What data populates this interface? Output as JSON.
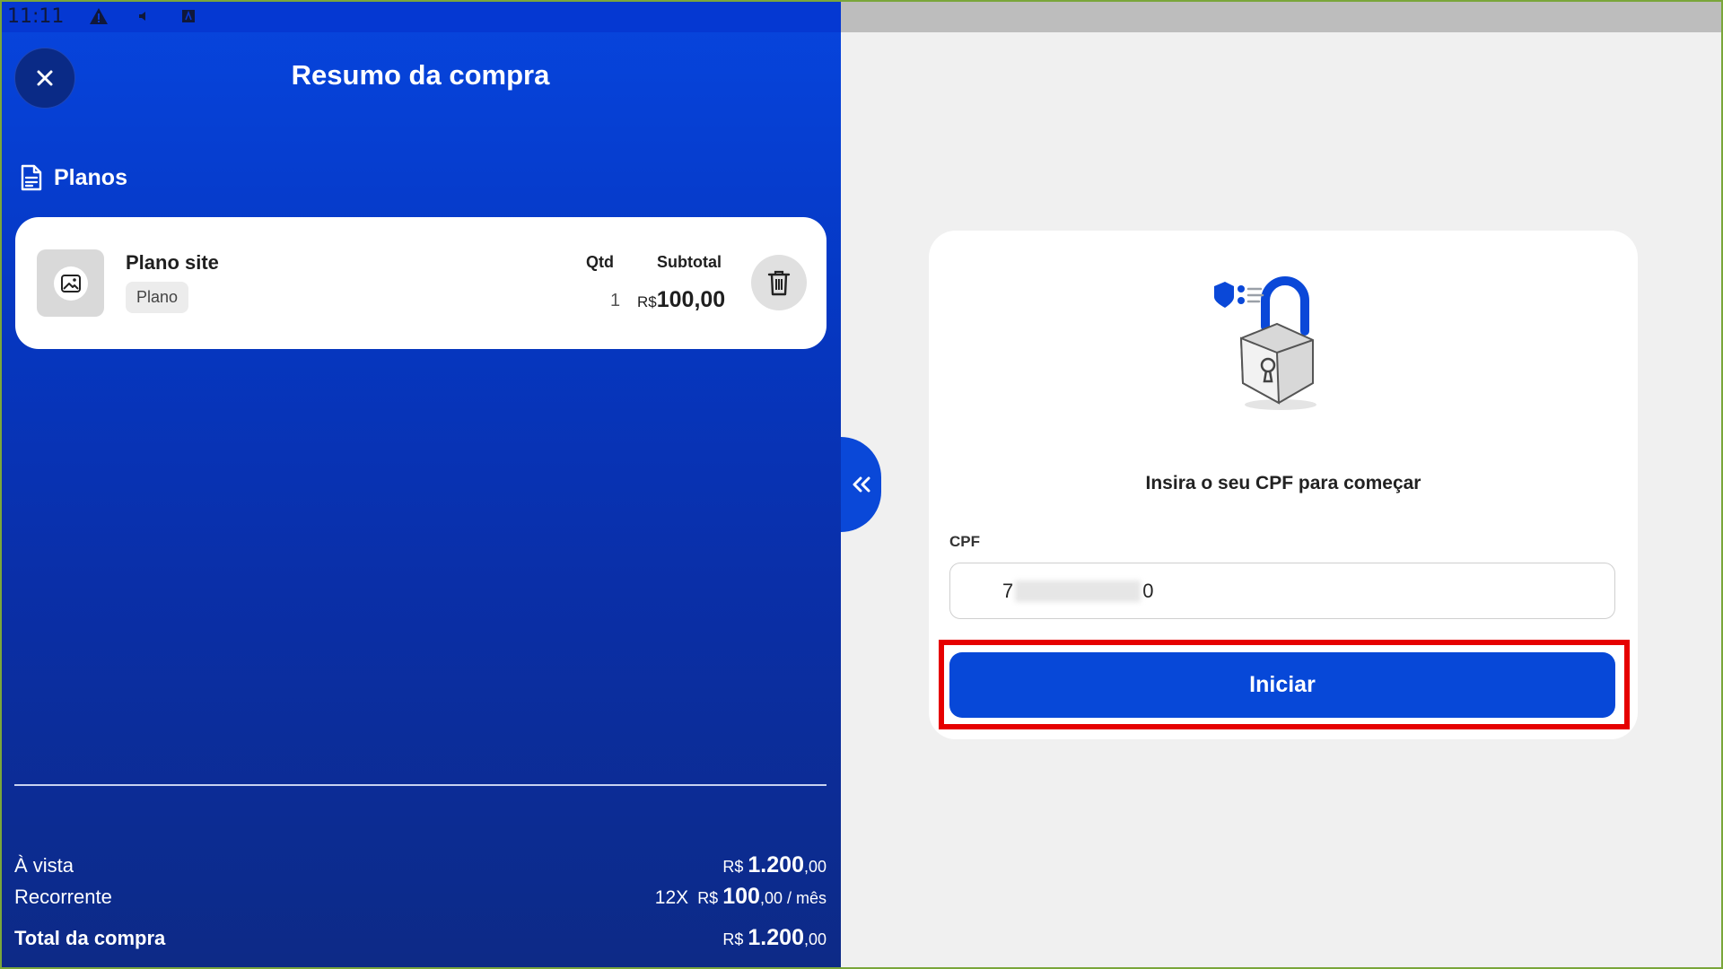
{
  "status_bar": {
    "time": "11:11"
  },
  "header": {
    "title": "Resumo da compra"
  },
  "section": {
    "title": "Planos"
  },
  "plan": {
    "name": "Plano site",
    "tag": "Plano",
    "qtd_label": "Qtd",
    "subtotal_label": "Subtotal",
    "qtd_value": "1",
    "subtotal_currency": "R$",
    "subtotal_value": "100,00"
  },
  "summary": {
    "a_vista_label": "À vista",
    "a_vista_currency": "R$",
    "a_vista_int": "1.200",
    "a_vista_dec": ",00",
    "recorrente_label": "Recorrente",
    "recorrente_times": "12X",
    "recorrente_currency": "R$",
    "recorrente_int": "100",
    "recorrente_dec": ",00",
    "recorrente_suffix": "/ mês",
    "total_label": "Total da compra",
    "total_currency": "R$",
    "total_int": "1.200",
    "total_dec": ",00"
  },
  "cpf_form": {
    "prompt": "Insira o seu CPF para começar",
    "label": "CPF",
    "value_start": "7",
    "value_end": "0",
    "start_button": "Iniciar"
  },
  "colors": {
    "brand_blue": "#0748d8",
    "highlight_red": "#e60000"
  }
}
